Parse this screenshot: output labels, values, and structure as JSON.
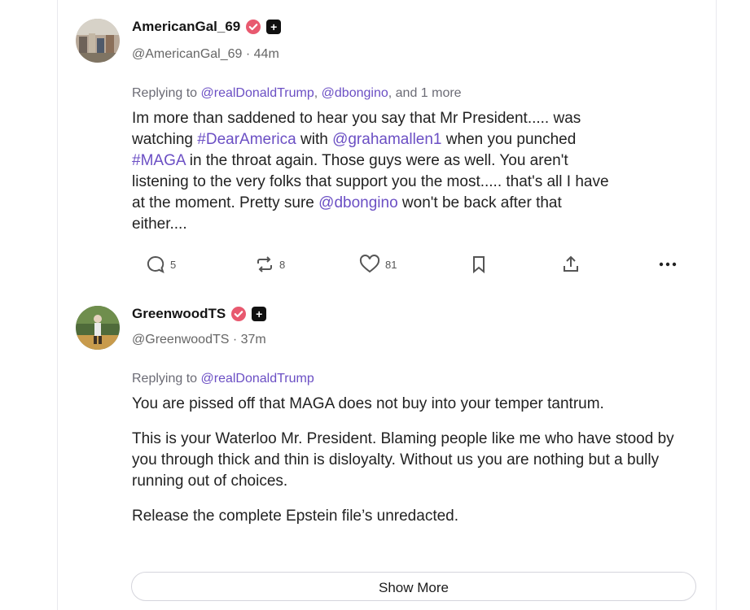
{
  "posts": [
    {
      "display_name": "AmericanGal_69",
      "handle": "@AmericanGal_69",
      "time": "44m",
      "reply_prefix": "Replying to ",
      "reply_mentions": [
        "@realDonaldTrump",
        "@dbongino"
      ],
      "reply_suffix": ", and 1 more",
      "body_lines": [
        [
          {
            "t": "Im more than saddened to hear you say that Mr President..... was",
            "m": false
          }
        ],
        [
          {
            "t": "watching ",
            "m": false
          },
          {
            "t": "#DearAmerica",
            "m": true
          },
          {
            "t": " with ",
            "m": false
          },
          {
            "t": "@grahamallen1",
            "m": true
          },
          {
            "t": " when you punched",
            "m": false
          }
        ],
        [
          {
            "t": "#MAGA",
            "m": true
          },
          {
            "t": " in the throat again. Those guys were as well. You aren't",
            "m": false
          }
        ],
        [
          {
            "t": "listening to the very folks that support you the most..... that's all I have",
            "m": false
          }
        ],
        [
          {
            "t": "at the moment. Pretty sure ",
            "m": false
          },
          {
            "t": "@dbongino",
            "m": true
          },
          {
            "t": " won't be back after that",
            "m": false
          }
        ],
        [
          {
            "t": "either....",
            "m": false
          }
        ]
      ],
      "actions": {
        "replies": "5",
        "reposts": "8",
        "likes": "81"
      }
    },
    {
      "display_name": "GreenwoodTS",
      "handle": "@GreenwoodTS",
      "time": "37m",
      "reply_prefix": "Replying to ",
      "reply_mentions": [
        "@realDonaldTrump"
      ],
      "paragraphs": [
        "You are pissed off that MAGA does not buy into your temper tantrum.",
        "This is your Waterloo Mr. President. Blaming people like me who have stood by you through thick and thin is disloyalty. Without us you are nothing but a bully running out of choices.",
        "Release the complete Epstein file’s unredacted."
      ]
    }
  ],
  "dot_separator": " · ",
  "show_more_label": "Show More",
  "colors": {
    "mention": "#6b4fc4",
    "verified": "#e8596f",
    "plus_badge": "#111111"
  },
  "icons": [
    "verified-badge-icon",
    "plus-badge-icon",
    "reply-icon",
    "repost-icon",
    "like-icon",
    "bookmark-icon",
    "share-icon",
    "more-icon"
  ]
}
